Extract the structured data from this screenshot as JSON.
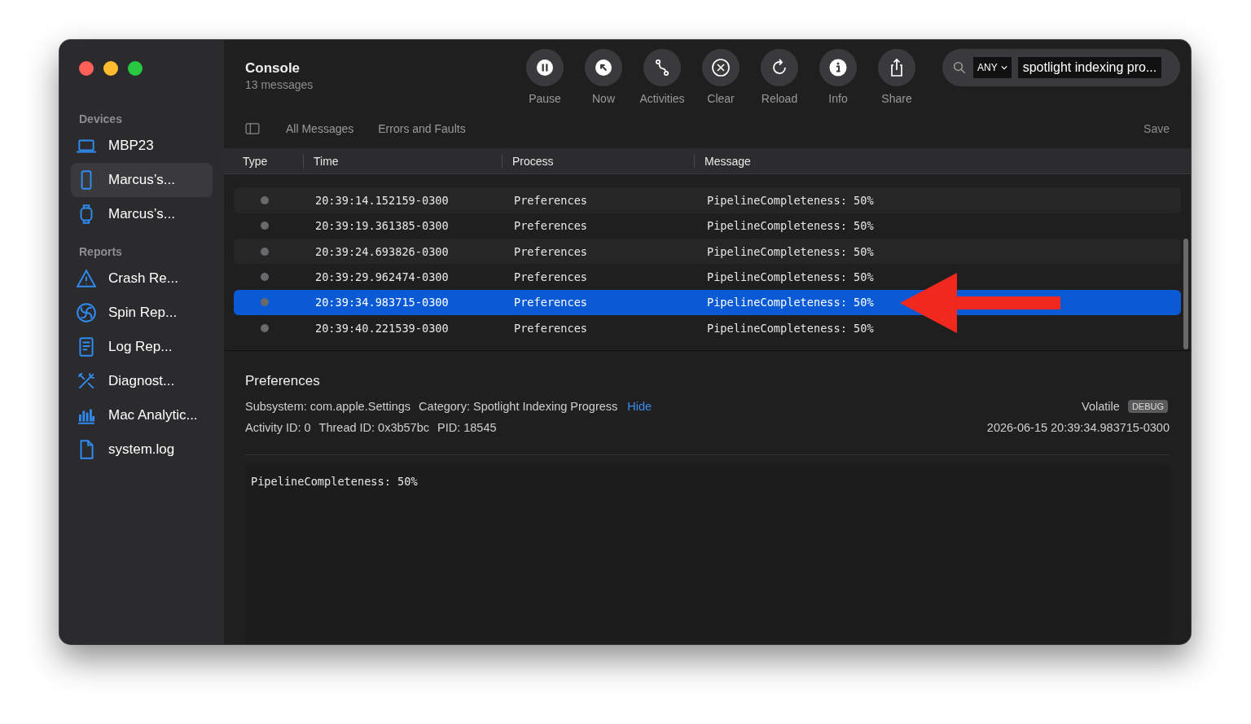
{
  "window": {
    "title": "Console",
    "subtitle": "13 messages"
  },
  "sidebar": {
    "sections": [
      {
        "heading": "Devices",
        "items": [
          {
            "label": "MBP23",
            "kind": "laptop",
            "selected": false
          },
          {
            "label": "Marcus’s...",
            "kind": "phone",
            "selected": true
          },
          {
            "label": "Marcus’s...",
            "kind": "watch",
            "selected": false
          }
        ]
      },
      {
        "heading": "Reports",
        "items": [
          {
            "label": "Crash Re...",
            "kind": "warning",
            "selected": false
          },
          {
            "label": "Spin Rep...",
            "kind": "spin",
            "selected": false
          },
          {
            "label": "Log Rep...",
            "kind": "document",
            "selected": false
          },
          {
            "label": "Diagnost...",
            "kind": "tools",
            "selected": false
          },
          {
            "label": "Mac Analytic...",
            "kind": "chart",
            "selected": false
          },
          {
            "label": "system.log",
            "kind": "file",
            "selected": false
          }
        ]
      }
    ]
  },
  "toolbar": {
    "buttons": [
      {
        "label": "Pause",
        "kind": "pause"
      },
      {
        "label": "Now",
        "kind": "now"
      },
      {
        "label": "Activities",
        "kind": "activities"
      },
      {
        "label": "Clear",
        "kind": "clear"
      },
      {
        "label": "Reload",
        "kind": "reload"
      },
      {
        "label": "Info",
        "kind": "info"
      },
      {
        "label": "Share",
        "kind": "share"
      }
    ]
  },
  "search": {
    "scope": "ANY",
    "value": "spotlight indexing pro..."
  },
  "filters": [
    "All Messages",
    "Errors and Faults"
  ],
  "save_button": "Save",
  "table": {
    "columns": [
      "Type",
      "Time",
      "Process",
      "Message"
    ],
    "rows": [
      {
        "time": "20:39:14.152159-0300",
        "process": "Preferences",
        "message": "PipelineCompleteness: 50%",
        "selected": false
      },
      {
        "time": "20:39:19.361385-0300",
        "process": "Preferences",
        "message": "PipelineCompleteness: 50%",
        "selected": false
      },
      {
        "time": "20:39:24.693826-0300",
        "process": "Preferences",
        "message": "PipelineCompleteness: 50%",
        "selected": false
      },
      {
        "time": "20:39:29.962474-0300",
        "process": "Preferences",
        "message": "PipelineCompleteness: 50%",
        "selected": false
      },
      {
        "time": "20:39:34.983715-0300",
        "process": "Preferences",
        "message": "PipelineCompleteness: 50%",
        "selected": true
      },
      {
        "time": "20:39:40.221539-0300",
        "process": "Preferences",
        "message": "PipelineCompleteness: 50%",
        "selected": false
      }
    ]
  },
  "annotation": {
    "kind": "arrow"
  },
  "detail": {
    "process": "Preferences",
    "subsystem": "Subsystem: com.apple.Settings",
    "category": "Category: Spotlight Indexing Progress",
    "hide_link": "Hide",
    "volatile": "Volatile",
    "badge": "DEBUG",
    "activity_id": "Activity ID: 0",
    "thread_id": "Thread ID: 0x3b57bc",
    "pid": "PID: 18545",
    "timestamp": "2026-06-15 20:39:34.983715-0300",
    "body": "PipelineCompleteness: 50%"
  }
}
